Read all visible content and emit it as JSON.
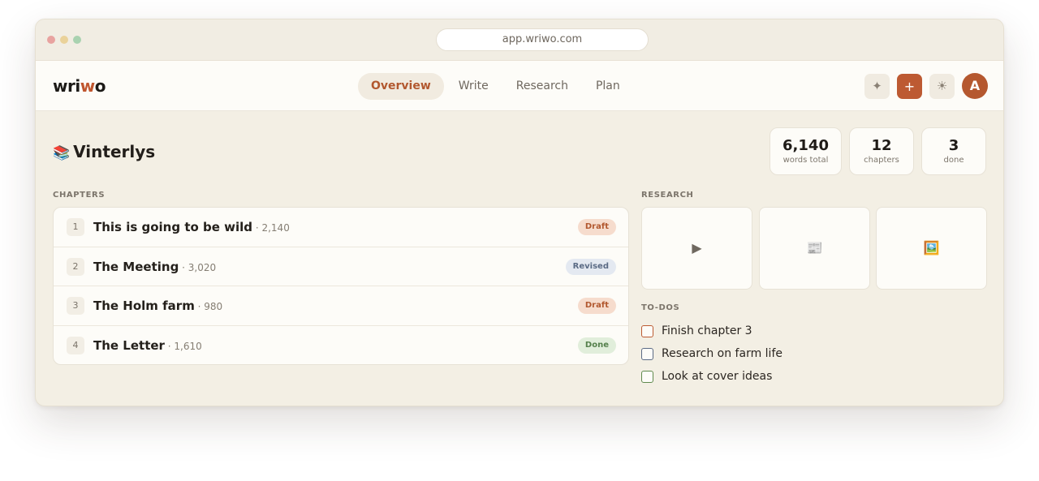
{
  "browser": {
    "url": "app.wriwo.com"
  },
  "header": {
    "logo_main": "wri",
    "logo_accent": "w",
    "logo_end": "o",
    "tabs": [
      {
        "label": "Overview",
        "active": true
      },
      {
        "label": "Write",
        "active": false
      },
      {
        "label": "Research",
        "active": false
      },
      {
        "label": "Plan",
        "active": false
      }
    ],
    "sparkle_icon": "✦",
    "add_icon": "+",
    "theme_icon": "☀",
    "avatar_initial": "A"
  },
  "book": {
    "emoji": "📚",
    "title": "Vinterlys"
  },
  "stats": [
    {
      "value": "6,140",
      "label": "words total"
    },
    {
      "value": "12",
      "label": "chapters"
    },
    {
      "value": "3",
      "label": "done"
    }
  ],
  "chapters": {
    "label": "CHAPTERS",
    "items": [
      {
        "num": "1",
        "title": "This is going to be wild",
        "words": " · 2,140",
        "status": "Draft"
      },
      {
        "num": "2",
        "title": "The Meeting",
        "words": " · 3,020",
        "status": "Revised"
      },
      {
        "num": "3",
        "title": "The Holm farm",
        "words": " · 980",
        "status": "Draft"
      },
      {
        "num": "4",
        "title": "The Letter",
        "words": " · 1,610",
        "status": "Done"
      }
    ]
  },
  "research": {
    "label": "RESEARCH",
    "cards": [
      {
        "icon": "▶",
        "icon_name": "video-play-icon"
      },
      {
        "icon": "📰",
        "icon_name": "newspaper-icon"
      },
      {
        "icon": "🖼️",
        "icon_name": "picture-icon"
      }
    ]
  },
  "todos": {
    "label": "TO-DOS",
    "items": [
      {
        "text": "Finish chapter 3",
        "color": "#bc5b33"
      },
      {
        "text": "Research on farm life",
        "color": "#5b6b85"
      },
      {
        "text": "Look at cover ideas",
        "color": "#5f8a4e"
      }
    ]
  },
  "colors": {
    "accent": "#bd5a32",
    "background": "#f3efe4",
    "card": "#fdfcf8"
  }
}
